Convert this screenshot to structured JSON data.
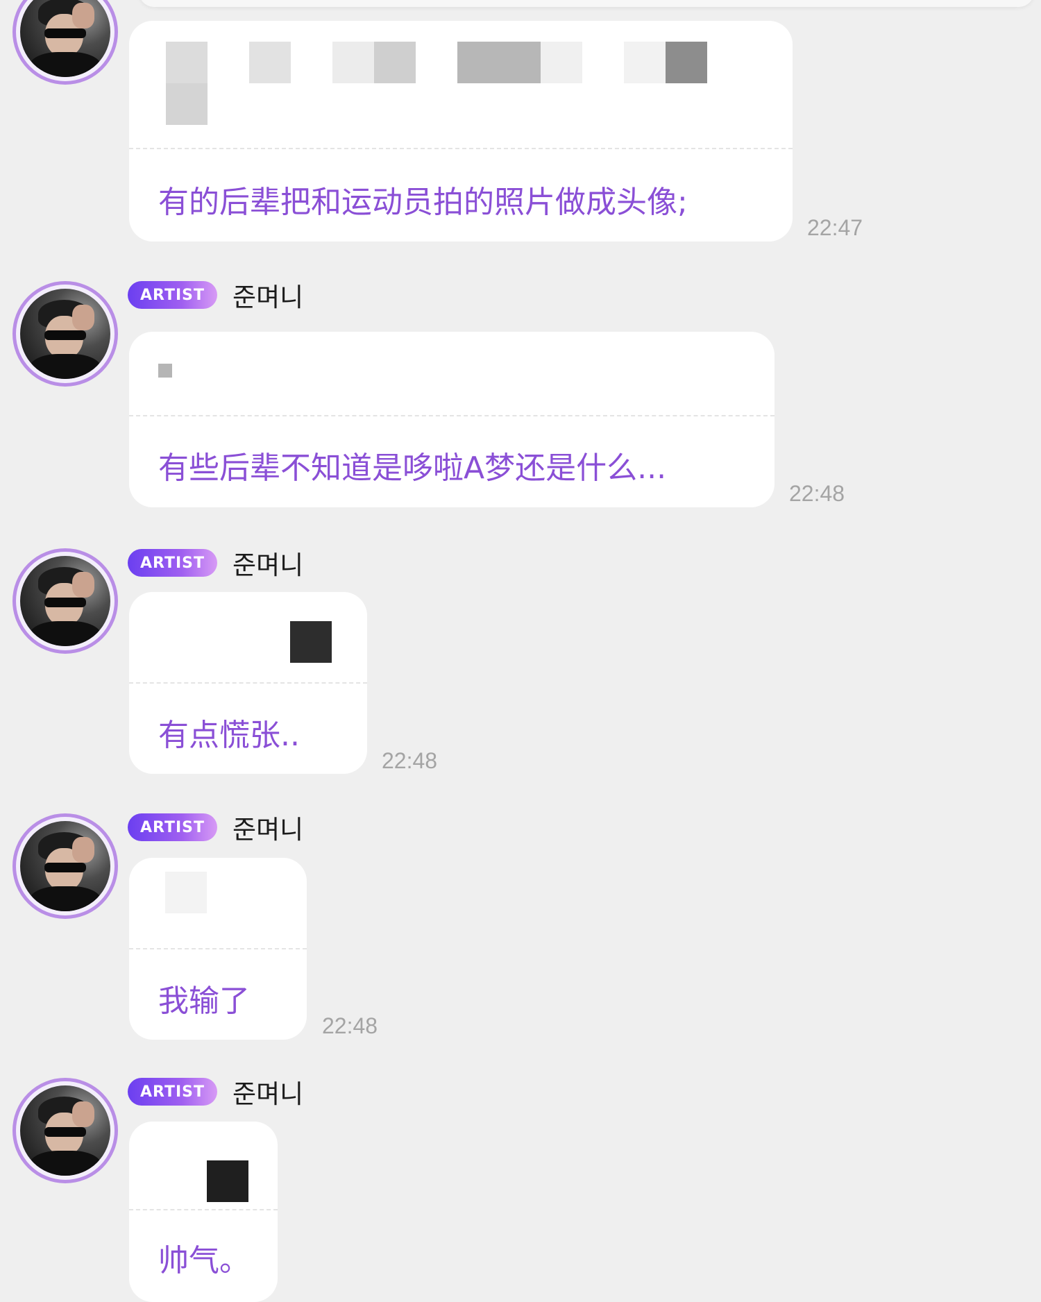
{
  "messages": [
    {
      "badge": "",
      "sender": "",
      "translation": "有的后辈把和运动员拍的照片做成头像;",
      "time": "22:47"
    },
    {
      "badge": "ARTIST",
      "sender": "준며니",
      "translation": "有些后辈不知道是哆啦A梦还是什么...",
      "time": "22:48"
    },
    {
      "badge": "ARTIST",
      "sender": "준며니",
      "translation": "有点慌张..",
      "time": "22:48"
    },
    {
      "badge": "ARTIST",
      "sender": "준며니",
      "translation": "我输了",
      "time": "22:48"
    },
    {
      "badge": "ARTIST",
      "sender": "준며니",
      "translation": "帅气。",
      "time": ""
    }
  ],
  "colors": {
    "background": "#efefef",
    "bubble": "#ffffff",
    "translation_text": "#8a4fd6",
    "badge_gradient_start": "#6b3ff0",
    "badge_gradient_end": "#d79af5",
    "avatar_ring": "#b98ee6",
    "timestamp": "#a4a4a4"
  },
  "icons": {
    "avatar": "artist-avatar-photo"
  }
}
